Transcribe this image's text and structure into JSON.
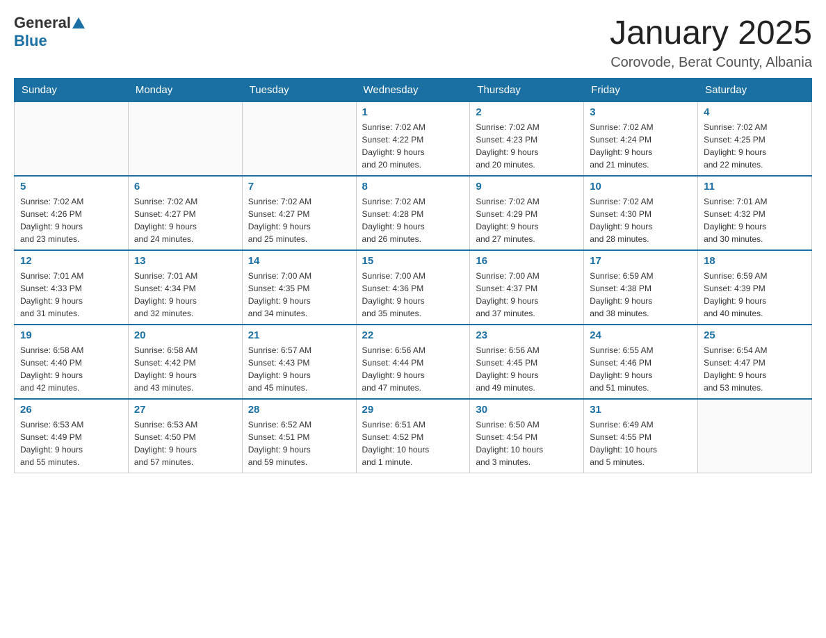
{
  "header": {
    "logo_general": "General",
    "logo_blue": "Blue",
    "title": "January 2025",
    "subtitle": "Corovode, Berat County, Albania"
  },
  "days_of_week": [
    "Sunday",
    "Monday",
    "Tuesday",
    "Wednesday",
    "Thursday",
    "Friday",
    "Saturday"
  ],
  "weeks": [
    [
      {
        "day": "",
        "info": ""
      },
      {
        "day": "",
        "info": ""
      },
      {
        "day": "",
        "info": ""
      },
      {
        "day": "1",
        "info": "Sunrise: 7:02 AM\nSunset: 4:22 PM\nDaylight: 9 hours\nand 20 minutes."
      },
      {
        "day": "2",
        "info": "Sunrise: 7:02 AM\nSunset: 4:23 PM\nDaylight: 9 hours\nand 20 minutes."
      },
      {
        "day": "3",
        "info": "Sunrise: 7:02 AM\nSunset: 4:24 PM\nDaylight: 9 hours\nand 21 minutes."
      },
      {
        "day": "4",
        "info": "Sunrise: 7:02 AM\nSunset: 4:25 PM\nDaylight: 9 hours\nand 22 minutes."
      }
    ],
    [
      {
        "day": "5",
        "info": "Sunrise: 7:02 AM\nSunset: 4:26 PM\nDaylight: 9 hours\nand 23 minutes."
      },
      {
        "day": "6",
        "info": "Sunrise: 7:02 AM\nSunset: 4:27 PM\nDaylight: 9 hours\nand 24 minutes."
      },
      {
        "day": "7",
        "info": "Sunrise: 7:02 AM\nSunset: 4:27 PM\nDaylight: 9 hours\nand 25 minutes."
      },
      {
        "day": "8",
        "info": "Sunrise: 7:02 AM\nSunset: 4:28 PM\nDaylight: 9 hours\nand 26 minutes."
      },
      {
        "day": "9",
        "info": "Sunrise: 7:02 AM\nSunset: 4:29 PM\nDaylight: 9 hours\nand 27 minutes."
      },
      {
        "day": "10",
        "info": "Sunrise: 7:02 AM\nSunset: 4:30 PM\nDaylight: 9 hours\nand 28 minutes."
      },
      {
        "day": "11",
        "info": "Sunrise: 7:01 AM\nSunset: 4:32 PM\nDaylight: 9 hours\nand 30 minutes."
      }
    ],
    [
      {
        "day": "12",
        "info": "Sunrise: 7:01 AM\nSunset: 4:33 PM\nDaylight: 9 hours\nand 31 minutes."
      },
      {
        "day": "13",
        "info": "Sunrise: 7:01 AM\nSunset: 4:34 PM\nDaylight: 9 hours\nand 32 minutes."
      },
      {
        "day": "14",
        "info": "Sunrise: 7:00 AM\nSunset: 4:35 PM\nDaylight: 9 hours\nand 34 minutes."
      },
      {
        "day": "15",
        "info": "Sunrise: 7:00 AM\nSunset: 4:36 PM\nDaylight: 9 hours\nand 35 minutes."
      },
      {
        "day": "16",
        "info": "Sunrise: 7:00 AM\nSunset: 4:37 PM\nDaylight: 9 hours\nand 37 minutes."
      },
      {
        "day": "17",
        "info": "Sunrise: 6:59 AM\nSunset: 4:38 PM\nDaylight: 9 hours\nand 38 minutes."
      },
      {
        "day": "18",
        "info": "Sunrise: 6:59 AM\nSunset: 4:39 PM\nDaylight: 9 hours\nand 40 minutes."
      }
    ],
    [
      {
        "day": "19",
        "info": "Sunrise: 6:58 AM\nSunset: 4:40 PM\nDaylight: 9 hours\nand 42 minutes."
      },
      {
        "day": "20",
        "info": "Sunrise: 6:58 AM\nSunset: 4:42 PM\nDaylight: 9 hours\nand 43 minutes."
      },
      {
        "day": "21",
        "info": "Sunrise: 6:57 AM\nSunset: 4:43 PM\nDaylight: 9 hours\nand 45 minutes."
      },
      {
        "day": "22",
        "info": "Sunrise: 6:56 AM\nSunset: 4:44 PM\nDaylight: 9 hours\nand 47 minutes."
      },
      {
        "day": "23",
        "info": "Sunrise: 6:56 AM\nSunset: 4:45 PM\nDaylight: 9 hours\nand 49 minutes."
      },
      {
        "day": "24",
        "info": "Sunrise: 6:55 AM\nSunset: 4:46 PM\nDaylight: 9 hours\nand 51 minutes."
      },
      {
        "day": "25",
        "info": "Sunrise: 6:54 AM\nSunset: 4:47 PM\nDaylight: 9 hours\nand 53 minutes."
      }
    ],
    [
      {
        "day": "26",
        "info": "Sunrise: 6:53 AM\nSunset: 4:49 PM\nDaylight: 9 hours\nand 55 minutes."
      },
      {
        "day": "27",
        "info": "Sunrise: 6:53 AM\nSunset: 4:50 PM\nDaylight: 9 hours\nand 57 minutes."
      },
      {
        "day": "28",
        "info": "Sunrise: 6:52 AM\nSunset: 4:51 PM\nDaylight: 9 hours\nand 59 minutes."
      },
      {
        "day": "29",
        "info": "Sunrise: 6:51 AM\nSunset: 4:52 PM\nDaylight: 10 hours\nand 1 minute."
      },
      {
        "day": "30",
        "info": "Sunrise: 6:50 AM\nSunset: 4:54 PM\nDaylight: 10 hours\nand 3 minutes."
      },
      {
        "day": "31",
        "info": "Sunrise: 6:49 AM\nSunset: 4:55 PM\nDaylight: 10 hours\nand 5 minutes."
      },
      {
        "day": "",
        "info": ""
      }
    ]
  ]
}
